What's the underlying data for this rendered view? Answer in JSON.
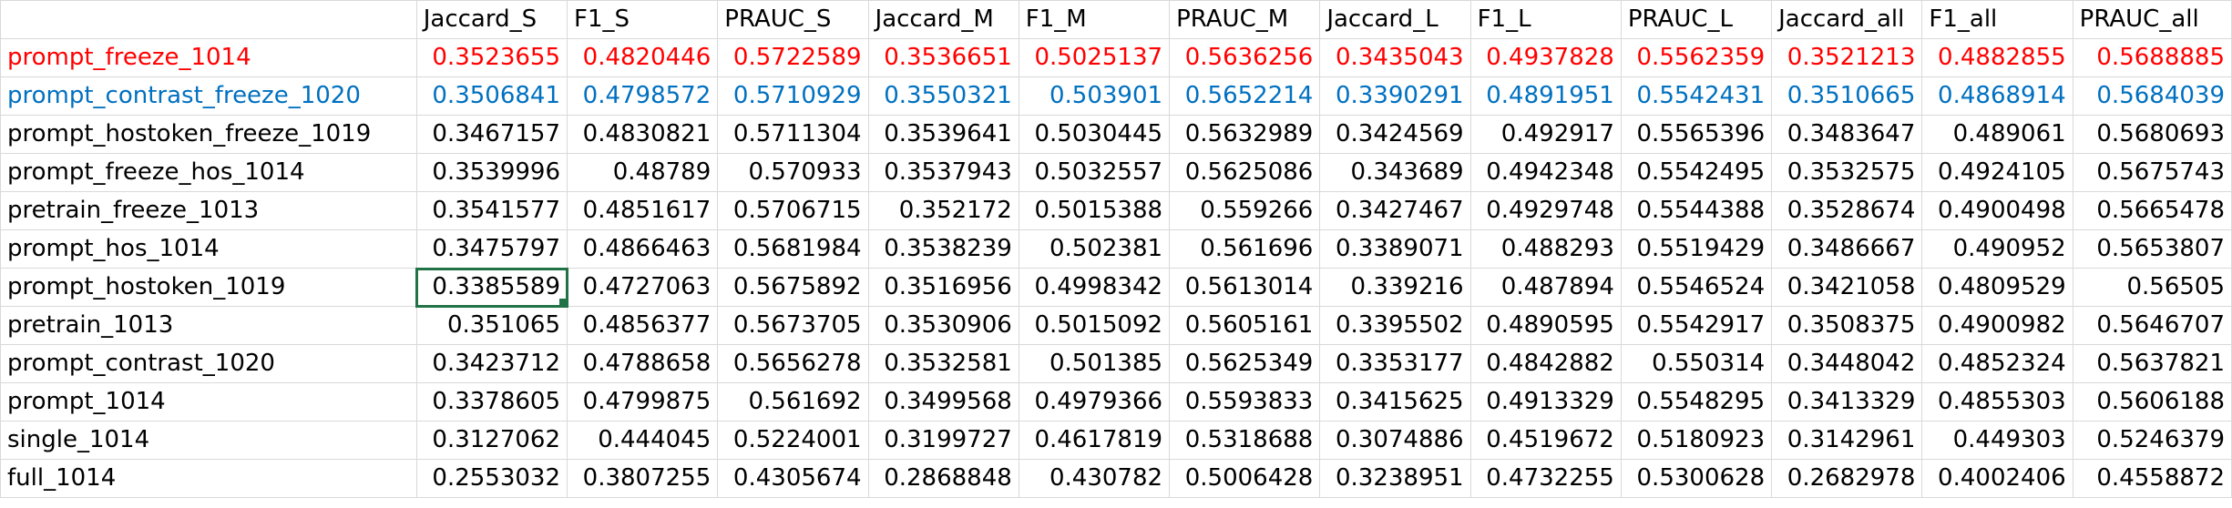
{
  "spreadsheet": {
    "headers": [
      "",
      "Jaccard_S",
      "F1_S",
      "PRAUC_S",
      "Jaccard_M",
      "F1_M",
      "PRAUC_M",
      "Jaccard_L",
      "F1_L",
      "PRAUC_L",
      "Jaccard_all",
      "F1_all",
      "PRAUC_all"
    ],
    "rows": [
      {
        "name": "prompt_freeze_1014",
        "color": "red",
        "values": [
          "0.3523655",
          "0.4820446",
          "0.5722589",
          "0.3536651",
          "0.5025137",
          "0.5636256",
          "0.3435043",
          "0.4937828",
          "0.5562359",
          "0.3521213",
          "0.4882855",
          "0.5688885"
        ]
      },
      {
        "name": "prompt_contrast_freeze_1020",
        "color": "blue",
        "values": [
          "0.3506841",
          "0.4798572",
          "0.5710929",
          "0.3550321",
          "0.503901",
          "0.5652214",
          "0.3390291",
          "0.4891951",
          "0.5542431",
          "0.3510665",
          "0.4868914",
          "0.5684039"
        ]
      },
      {
        "name": "prompt_hostoken_freeze_1019",
        "color": "black",
        "values": [
          "0.3467157",
          "0.4830821",
          "0.5711304",
          "0.3539641",
          "0.5030445",
          "0.5632989",
          "0.3424569",
          "0.492917",
          "0.5565396",
          "0.3483647",
          "0.489061",
          "0.5680693"
        ]
      },
      {
        "name": "prompt_freeze_hos_1014",
        "color": "black",
        "values": [
          "0.3539996",
          "0.48789",
          "0.570933",
          "0.3537943",
          "0.5032557",
          "0.5625086",
          "0.343689",
          "0.4942348",
          "0.5542495",
          "0.3532575",
          "0.4924105",
          "0.5675743"
        ]
      },
      {
        "name": "pretrain_freeze_1013",
        "color": "black",
        "values": [
          "0.3541577",
          "0.4851617",
          "0.5706715",
          "0.352172",
          "0.5015388",
          "0.559266",
          "0.3427467",
          "0.4929748",
          "0.5544388",
          "0.3528674",
          "0.4900498",
          "0.5665478"
        ]
      },
      {
        "name": "prompt_hos_1014",
        "color": "black",
        "values": [
          "0.3475797",
          "0.4866463",
          "0.5681984",
          "0.3538239",
          "0.502381",
          "0.561696",
          "0.3389071",
          "0.488293",
          "0.5519429",
          "0.3486667",
          "0.490952",
          "0.5653807"
        ]
      },
      {
        "name": "prompt_hostoken_1019",
        "color": "black",
        "selected_col": 0,
        "values": [
          "0.3385589",
          "0.4727063",
          "0.5675892",
          "0.3516956",
          "0.4998342",
          "0.5613014",
          "0.339216",
          "0.487894",
          "0.5546524",
          "0.3421058",
          "0.4809529",
          "0.56505"
        ]
      },
      {
        "name": "pretrain_1013",
        "color": "black",
        "values": [
          "0.351065",
          "0.4856377",
          "0.5673705",
          "0.3530906",
          "0.5015092",
          "0.5605161",
          "0.3395502",
          "0.4890595",
          "0.5542917",
          "0.3508375",
          "0.4900982",
          "0.5646707"
        ]
      },
      {
        "name": "prompt_contrast_1020",
        "color": "black",
        "values": [
          "0.3423712",
          "0.4788658",
          "0.5656278",
          "0.3532581",
          "0.501385",
          "0.5625349",
          "0.3353177",
          "0.4842882",
          "0.550314",
          "0.3448042",
          "0.4852324",
          "0.5637821"
        ]
      },
      {
        "name": "prompt_1014",
        "color": "black",
        "values": [
          "0.3378605",
          "0.4799875",
          "0.561692",
          "0.3499568",
          "0.4979366",
          "0.5593833",
          "0.3415625",
          "0.4913329",
          "0.5548295",
          "0.3413329",
          "0.4855303",
          "0.5606188"
        ]
      },
      {
        "name": "single_1014",
        "color": "black",
        "values": [
          "0.3127062",
          "0.444045",
          "0.5224001",
          "0.3199727",
          "0.4617819",
          "0.5318688",
          "0.3074886",
          "0.4519672",
          "0.5180923",
          "0.3142961",
          "0.449303",
          "0.5246379"
        ]
      },
      {
        "name": "full_1014",
        "color": "black",
        "values": [
          "0.2553032",
          "0.3807255",
          "0.4305674",
          "0.2868848",
          "0.430782",
          "0.5006428",
          "0.3238951",
          "0.4732255",
          "0.5300628",
          "0.2682978",
          "0.4002406",
          "0.4558872"
        ]
      }
    ],
    "colors": {
      "red": "#ff0000",
      "blue": "#0070c0",
      "selection": "#217346",
      "gridline": "#d9d9d9"
    }
  }
}
